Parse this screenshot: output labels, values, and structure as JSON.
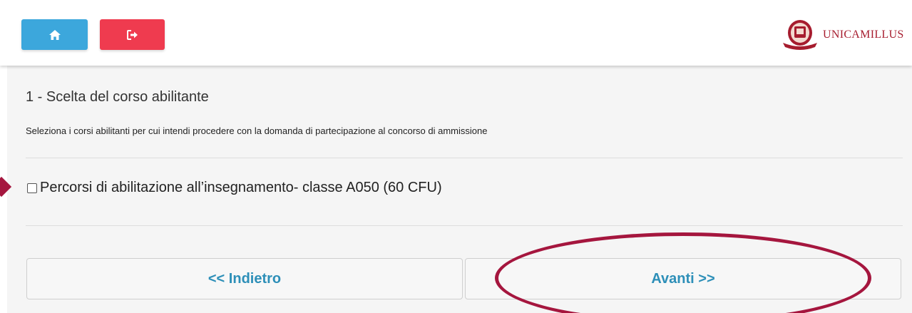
{
  "header": {
    "home_icon": "home-icon",
    "logout_icon": "sign-out-icon",
    "logo_text": "UNICAMILLUS"
  },
  "colors": {
    "home_button": "#3ca7dc",
    "logout_button": "#ef3b4f",
    "brand": "#a61c2e",
    "link": "#2d8fb8",
    "annotation": "#a5163e"
  },
  "step": {
    "title": "1 - Scelta del corso abilitante",
    "instruction": "Seleziona i corsi abilitanti per cui intendi procedere con la domanda di partecipazione al concorso di ammissione"
  },
  "courses": [
    {
      "label": "Percorsi di abilitazione all’insegnamento- classe A050 (60 CFU)",
      "checked": false
    }
  ],
  "navigation": {
    "back_label": "<< Indietro",
    "next_label": "Avanti >>"
  }
}
